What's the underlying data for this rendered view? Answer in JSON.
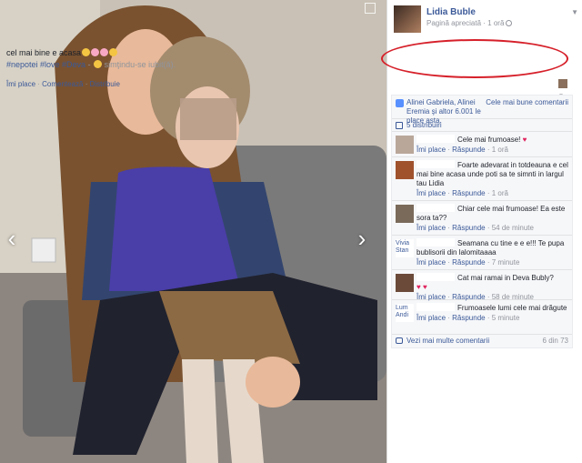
{
  "photo": {
    "nav_prev": "‹",
    "nav_next": "›"
  },
  "post": {
    "page_name": "Lidia Buble",
    "meta": "Pagină apreciată · 1 oră",
    "text_main": "cel mai bine e acasa",
    "hashtags": "#nepotei #love #Deva",
    "feeling": "simţindu-se iubit(ă).",
    "emoji_colors": [
      "#f4c542",
      "#f7a8c4",
      "#f7a8c4",
      "#f4c542"
    ]
  },
  "actions": {
    "like": "Îmi place",
    "comment": "Comentează",
    "share": "Distribuie"
  },
  "ufi": {
    "likers": "Alinei Gabriela, Alinei Eremia şi altor 6.001 le place asta.",
    "sort": "Cele mai bune comentarii",
    "shares": "5 distribuiri",
    "more_comments": "Vezi mai multe comentarii",
    "count": "6 din 73"
  },
  "comments": [
    {
      "text": "Cele mai frumoase!",
      "like": "Îmi place",
      "reply": "Răspunde",
      "time": "1 oră",
      "heart": "♥"
    },
    {
      "text": "Foarte adevarat in totdeauna e cel mai bine acasa unde poti sa te simnti in largul tau Lidia",
      "like": "Îmi place",
      "reply": "Răspunde",
      "time": "1 oră"
    },
    {
      "text": "Chiar cele mai frumoase! Ea este sora ta??",
      "like": "Îmi place",
      "reply": "Răspunde",
      "time": "54 de minute"
    },
    {
      "author": "Vivia Stan",
      "text": "Seamana cu tine e e e!!! Te pupa bublisorii din lalomitaaaa",
      "like": "Îmi place",
      "reply": "Răspunde",
      "time": "7 minute"
    },
    {
      "text": "Cat mai ramai in Deva Bubly?",
      "like": "Îmi place",
      "reply": "Răspunde",
      "time": "58 de minute",
      "hearts": "♥ ♥"
    },
    {
      "author": "Lum Andi",
      "text": "Frumoasele lumi cele mai drăgute",
      "like": "Îmi place",
      "reply": "Răspunde",
      "time": "5 minute"
    }
  ]
}
